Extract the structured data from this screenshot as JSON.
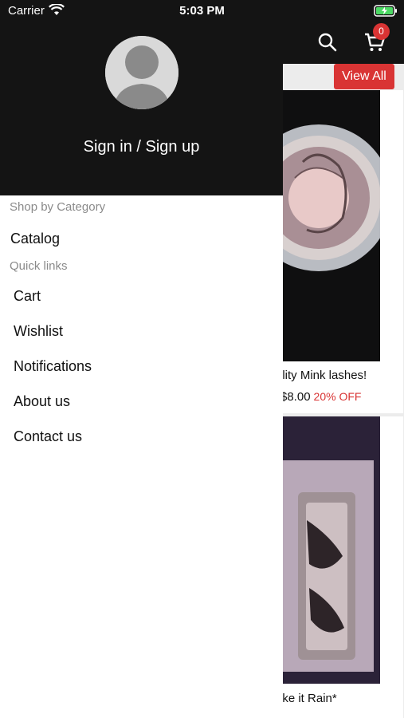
{
  "status_bar": {
    "carrier": "Carrier",
    "time": "5:03 PM"
  },
  "drawer": {
    "sign_in_label": "Sign in / Sign up",
    "shop_section_label": "Shop by Category",
    "catalog_label": "Catalog",
    "quick_links_label": "Quick links",
    "quick_links": [
      "Cart",
      "Wishlist",
      "Notifications",
      "About us",
      "Contact us"
    ]
  },
  "background": {
    "cart_count": "0",
    "view_all_label": "View All",
    "products": [
      {
        "title": "ality Mink lashes!",
        "price": "$8.00",
        "discount": "20% OFF"
      },
      {
        "title": "ake it Rain*"
      }
    ]
  },
  "colors": {
    "accent": "#d93434",
    "header": "#141414",
    "muted_text": "#8a8a8a"
  }
}
